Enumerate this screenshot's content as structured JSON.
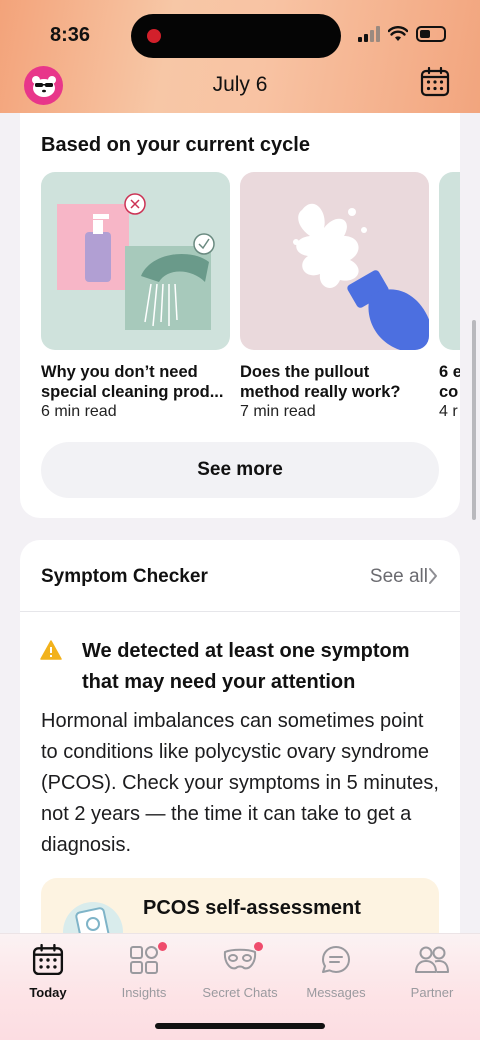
{
  "status_bar": {
    "time": "8:36"
  },
  "header": {
    "date": "July 6",
    "avatar_icon": "bear-avatar-icon",
    "calendar_icon": "calendar-icon"
  },
  "recommendations": {
    "title": "Based on your current cycle",
    "articles": [
      {
        "title": "Why you don’t need\nspecial cleaning prod...",
        "read_time": "6 min read"
      },
      {
        "title": "Does the pullout\nmethod really work?",
        "read_time": "7 min read"
      },
      {
        "title": "6 e\nco",
        "read_time": "4 r"
      }
    ],
    "see_more_label": "See more"
  },
  "symptom_checker": {
    "title": "Symptom Checker",
    "see_all_label": "See all",
    "alert": "We detected at least one symptom that may need your attention",
    "body": "Hormonal imbalances can sometimes point to conditions like polycystic ovary syndrome (PCOS). Check your symptoms in 5 minutes, not 2 years — the time it can take to get a diagnosis.",
    "assessment_title": "PCOS self-assessment"
  },
  "tabbar": {
    "tabs": [
      {
        "label": "Today",
        "icon": "calendar-icon"
      },
      {
        "label": "Insights",
        "icon": "grid-icon"
      },
      {
        "label": "Secret Chats",
        "icon": "mask-icon"
      },
      {
        "label": "Messages",
        "icon": "chat-bubble-icon"
      },
      {
        "label": "Partner",
        "icon": "partner-icon"
      }
    ]
  },
  "colors": {
    "accent": "#e8368a",
    "badge": "#ef4c6c",
    "warning": "#f2b21c"
  }
}
